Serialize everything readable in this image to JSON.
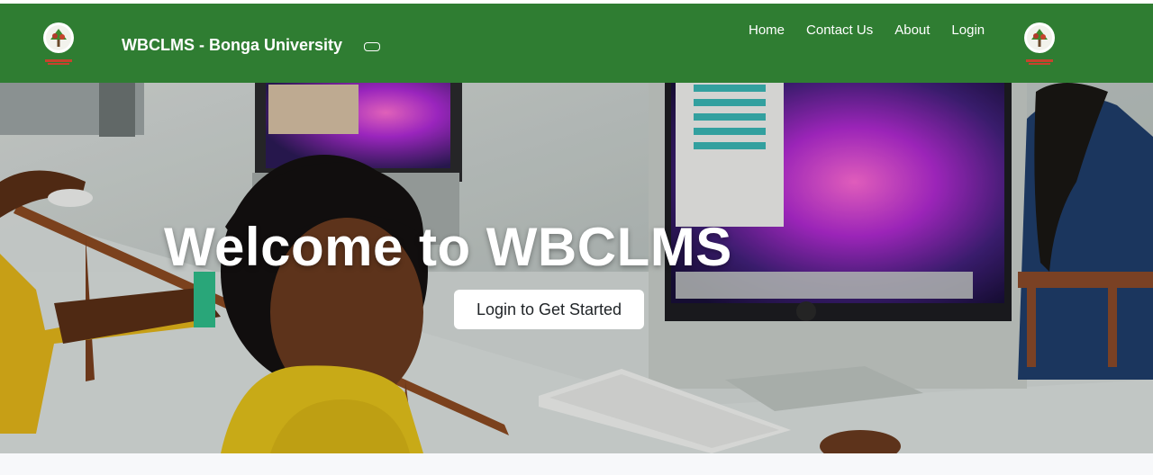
{
  "navbar": {
    "brand": "WBCLMS - Bonga University",
    "links": [
      {
        "label": "Home"
      },
      {
        "label": "Contact Us"
      },
      {
        "label": "About"
      },
      {
        "label": "Login"
      }
    ],
    "toggler_icon": "menu-toggle-icon"
  },
  "hero": {
    "title": "Welcome to WBCLMS",
    "cta_label": "Login to Get Started",
    "image_description_icon": "computer-lab-photo"
  },
  "colors": {
    "navbar_bg": "#2f7d32",
    "text_on_nav": "#ffffff",
    "cta_bg": "#ffffff"
  }
}
